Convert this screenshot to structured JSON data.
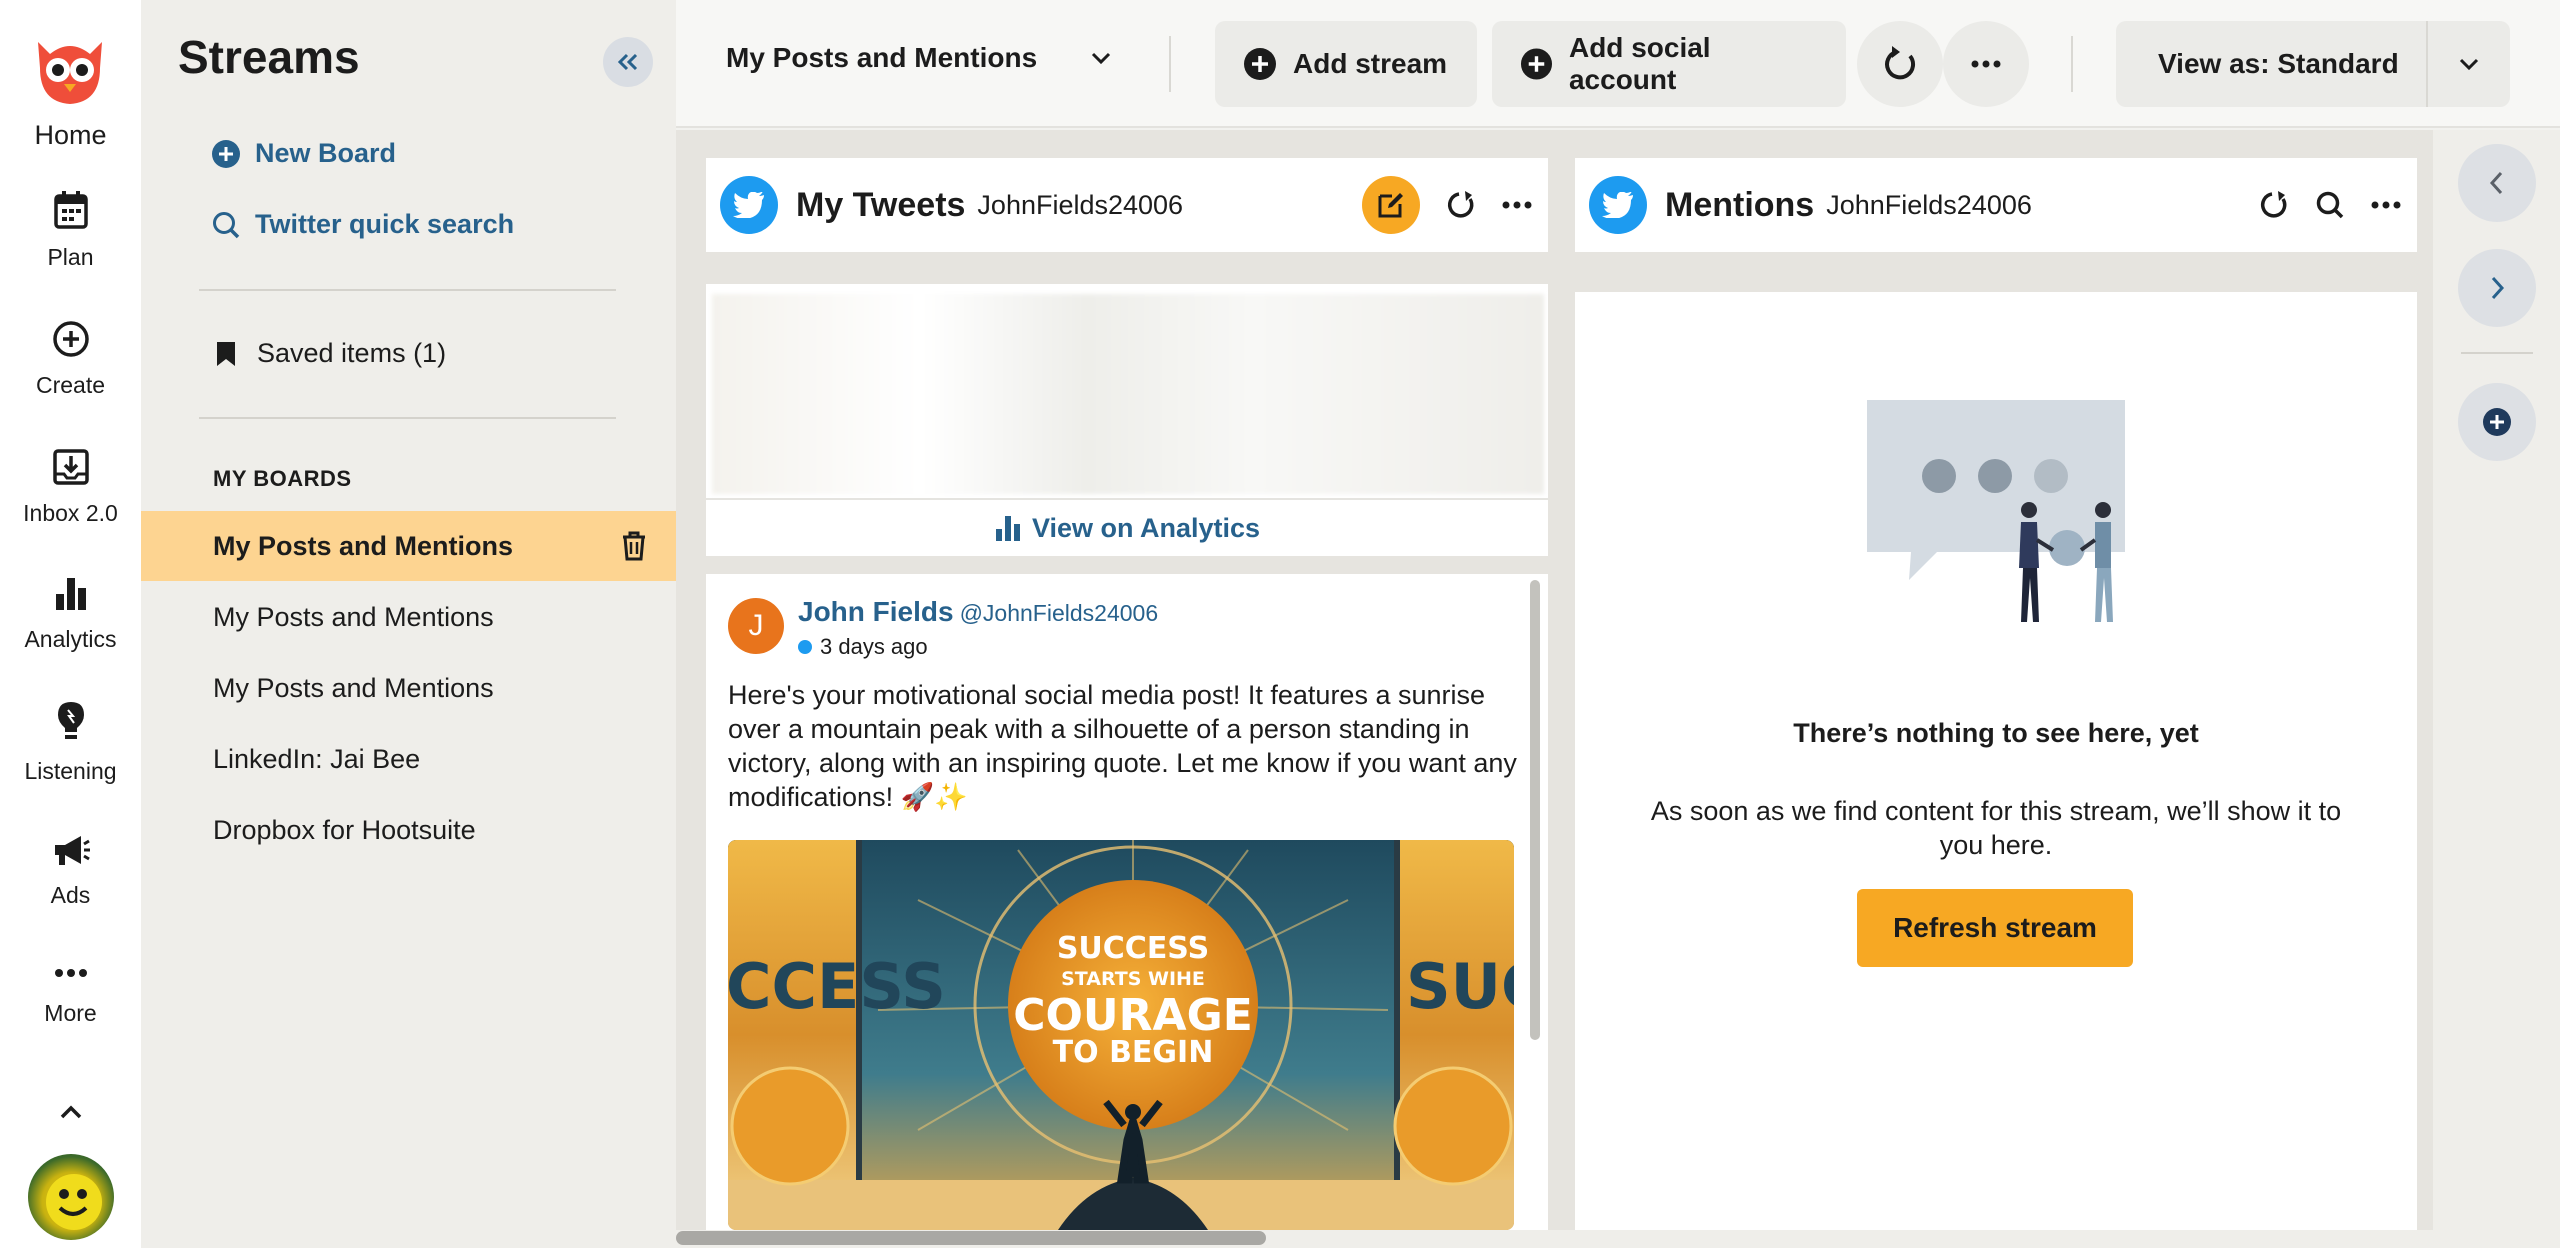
{
  "rail": {
    "home_label": "Home",
    "items": [
      {
        "label": "Plan",
        "icon": "calendar-icon"
      },
      {
        "label": "Create",
        "icon": "plus-circle-icon"
      },
      {
        "label": "Inbox 2.0",
        "icon": "inbox-icon"
      },
      {
        "label": "Analytics",
        "icon": "bar-chart-icon"
      },
      {
        "label": "Listening",
        "icon": "lightbulb-icon"
      },
      {
        "label": "Ads",
        "icon": "megaphone-icon"
      },
      {
        "label": "More",
        "icon": "more-horizontal-icon"
      }
    ]
  },
  "sidebar": {
    "title": "Streams",
    "new_board": "New Board",
    "quick_search": "Twitter quick search",
    "saved_items": "Saved items (1)",
    "boards_header": "MY BOARDS",
    "boards": [
      {
        "label": "My Posts and Mentions",
        "active": true
      },
      {
        "label": "My Posts and Mentions",
        "active": false
      },
      {
        "label": "My Posts and Mentions",
        "active": false
      },
      {
        "label": "LinkedIn: Jai Bee",
        "active": false
      },
      {
        "label": "Dropbox for Hootsuite",
        "active": false
      }
    ]
  },
  "topbar": {
    "board_select": "My Posts and Mentions",
    "add_stream": "Add stream",
    "add_social_account": "Add social account",
    "view_as": "View as: Standard"
  },
  "streams": {
    "tweets": {
      "title": "My Tweets",
      "user": "JohnFields24006",
      "view_analytics": "View on Analytics",
      "post": {
        "avatar_initial": "J",
        "name": "John Fields",
        "handle": "@JohnFields24006",
        "time": "3 days ago",
        "text": "Here's your motivational social media post! It features a sunrise over a mountain peak with a silhouette of a person standing in victory, along with an inspiring quote. Let me know if you want any modifications! 🚀✨",
        "image_text": {
          "line1": "SUCCESS",
          "line2": "STARTS WIHE",
          "line3": "COURAGE",
          "line4": "TO BEGIN",
          "side_left": "CCESS",
          "side_right": "SUC"
        }
      }
    },
    "mentions": {
      "title": "Mentions",
      "user": "JohnFields24006",
      "empty_title": "There’s nothing to see here, yet",
      "empty_desc": "As soon as we find content for this stream, we’ll show it to you here.",
      "refresh": "Refresh stream"
    }
  },
  "colors": {
    "brand_red": "#ef4e3a",
    "accent_orange": "#f7a823",
    "active_board": "#fdd491",
    "link_blue": "#27618c",
    "twitter_blue": "#1d9bf0"
  }
}
